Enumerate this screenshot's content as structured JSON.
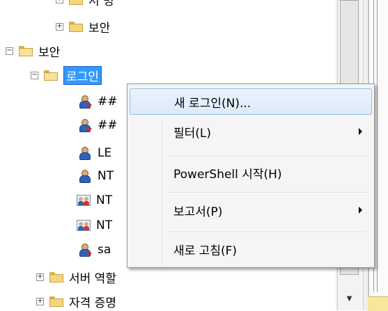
{
  "tree": {
    "items": [
      {
        "id": "partial-top",
        "label": "서 명"
      },
      {
        "id": "security-sub",
        "label": "보안",
        "expander": "+"
      },
      {
        "id": "security",
        "label": "보안",
        "expander": "−"
      },
      {
        "id": "logins",
        "label": "로그인",
        "expander": "−"
      },
      {
        "id": "login1",
        "label": "##"
      },
      {
        "id": "login2",
        "label": "##"
      },
      {
        "id": "login3",
        "label": "LE"
      },
      {
        "id": "login4",
        "label": "NT"
      },
      {
        "id": "login5",
        "label": "NT"
      },
      {
        "id": "login6",
        "label": "NT"
      },
      {
        "id": "login7",
        "label": "sa"
      },
      {
        "id": "server-roles",
        "label": "서버 역할",
        "expander": "+"
      },
      {
        "id": "credentials",
        "label": "자격 증명",
        "expander": "+"
      }
    ]
  },
  "context_menu": {
    "items": [
      {
        "label": "새 로그인(N)..."
      },
      {
        "label": "필터(L)",
        "submenu": true
      },
      {
        "label": "PowerShell 시작(H)"
      },
      {
        "label": "보고서(P)",
        "submenu": true
      },
      {
        "label": "새로 고침(F)"
      }
    ]
  },
  "colors": {
    "selection": "#3399ff",
    "menu_hover": "#dbeaf9",
    "menu_bg": "#f5f5f5"
  },
  "icons": {
    "expander": "plus-minus-box",
    "folder": "folder-icon",
    "user": "user-icon",
    "group": "group-icon",
    "submenu": "submenu-arrow-icon"
  }
}
